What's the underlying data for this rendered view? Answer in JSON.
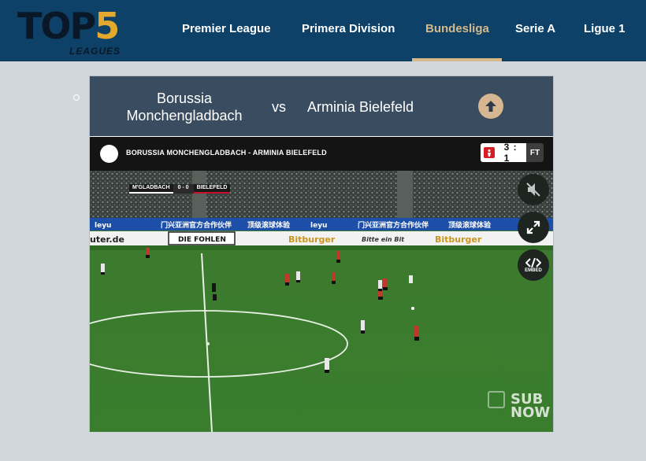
{
  "brand": {
    "logo_main": "TOP",
    "logo_number": "5",
    "logo_sub": "LEAGUES"
  },
  "nav": {
    "items": [
      {
        "label": "Premier League"
      },
      {
        "label": "Primera Division"
      },
      {
        "label": "Bundesliga"
      },
      {
        "label": "Serie A"
      },
      {
        "label": "Ligue 1"
      }
    ],
    "active": "Bundesliga"
  },
  "match": {
    "home_team": "Borussia Monchengladbach",
    "vs_label": "vs",
    "away_team": "Arminia Bielefeld",
    "up_icon": "arrow-up-icon"
  },
  "video": {
    "title": "BORUSSIA MONCHENGLADBACH - ARMINIA BIELEFELD",
    "score": "3 : 1",
    "status": "FT",
    "controls": {
      "mute_icon": "speaker-muted-icon",
      "fullscreen_icon": "fullscreen-icon",
      "embed_icon": "embed-code-icon",
      "embed_label": "EMBED"
    },
    "scorebug": {
      "home": "M'GLADBACH",
      "score": "0 - 0",
      "away": "BIELEFELD"
    },
    "watermark": "SUB NOW",
    "watermark_line1": "SUB",
    "watermark_line2": "NOW"
  },
  "colors": {
    "header_bg": "#0d4167",
    "accent": "#d5b98a",
    "match_bar": "#3a4c5f",
    "page_bg": "#d2d7de"
  }
}
